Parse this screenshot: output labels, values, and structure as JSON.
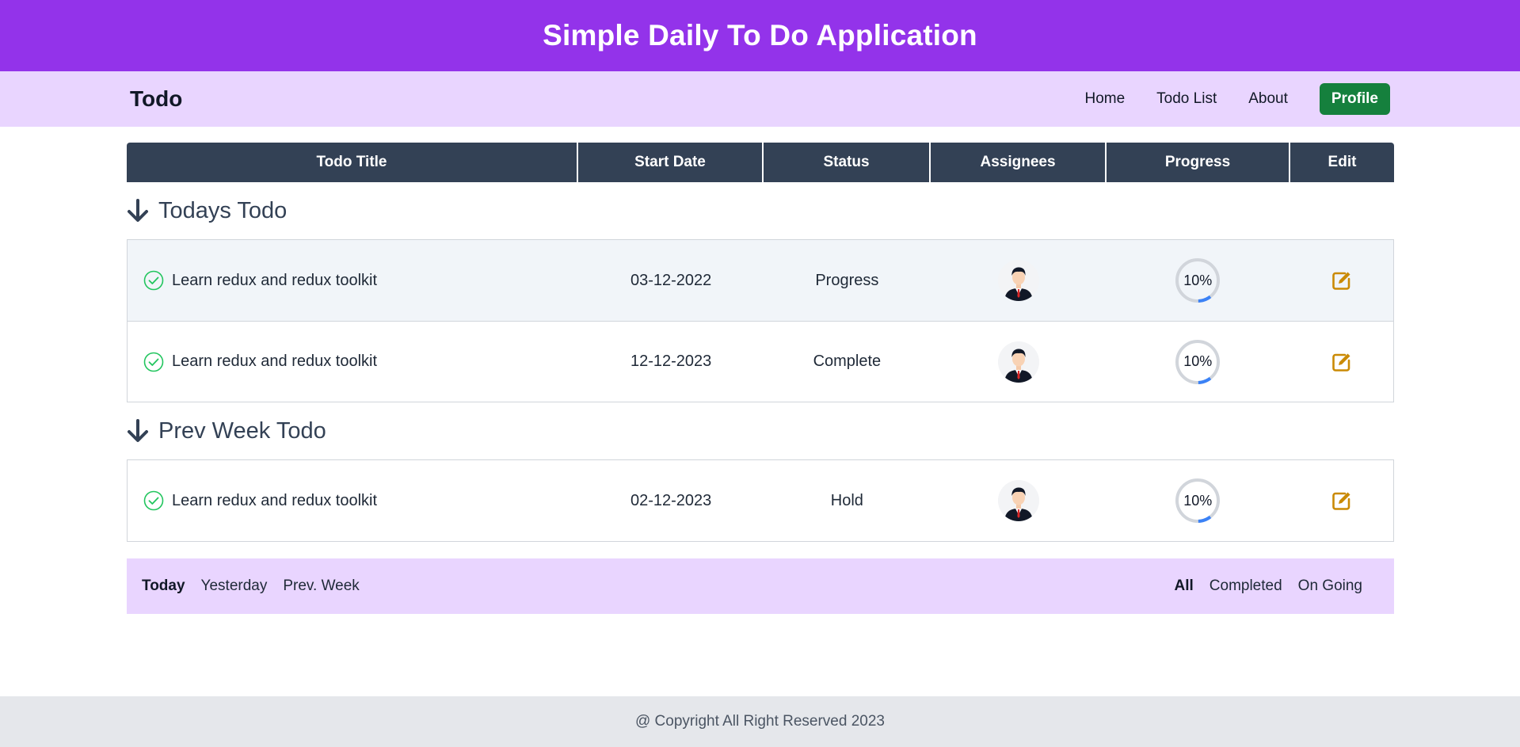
{
  "banner": {
    "title": "Simple Daily To Do Application"
  },
  "nav": {
    "brand": "Todo",
    "links": [
      "Home",
      "Todo List",
      "About"
    ],
    "profile_label": "Profile"
  },
  "table": {
    "headers": {
      "title": "Todo Title",
      "start_date": "Start Date",
      "status": "Status",
      "assignees": "Assignees",
      "progress": "Progress",
      "edit": "Edit"
    }
  },
  "sections": [
    {
      "title": "Todays Todo",
      "rows": [
        {
          "title": "Learn redux and redux toolkit",
          "start_date": "03-12-2022",
          "status": "Progress",
          "progress_label": "10%",
          "progress": 0.1
        },
        {
          "title": "Learn redux and redux toolkit",
          "start_date": "12-12-2023",
          "status": "Complete",
          "progress_label": "10%",
          "progress": 0.1
        }
      ]
    },
    {
      "title": "Prev Week Todo",
      "rows": [
        {
          "title": "Learn redux and redux toolkit",
          "start_date": "02-12-2023",
          "status": "Hold",
          "progress_label": "10%",
          "progress": 0.1
        }
      ]
    }
  ],
  "filters": {
    "left": [
      "Today",
      "Yesterday",
      "Prev. Week"
    ],
    "right": [
      "All",
      "Completed",
      "On Going"
    ],
    "active_left": "Today",
    "active_right": "All"
  },
  "footer": {
    "text": "@ Copyright All Right Reserved 2023"
  },
  "colors": {
    "banner": "#9333ea",
    "nav": "#e9d5ff",
    "table_header": "#334155",
    "profile_button": "#15803d",
    "check": "#22c55e",
    "edit": "#ca8a04",
    "progress_track": "#d1d5db",
    "progress_fill": "#3b82f6"
  },
  "icons": {
    "section_arrow": "arrow-down-icon",
    "row_check": "check-circle-icon",
    "edit": "edit-icon",
    "avatar": "user-avatar-icon"
  }
}
